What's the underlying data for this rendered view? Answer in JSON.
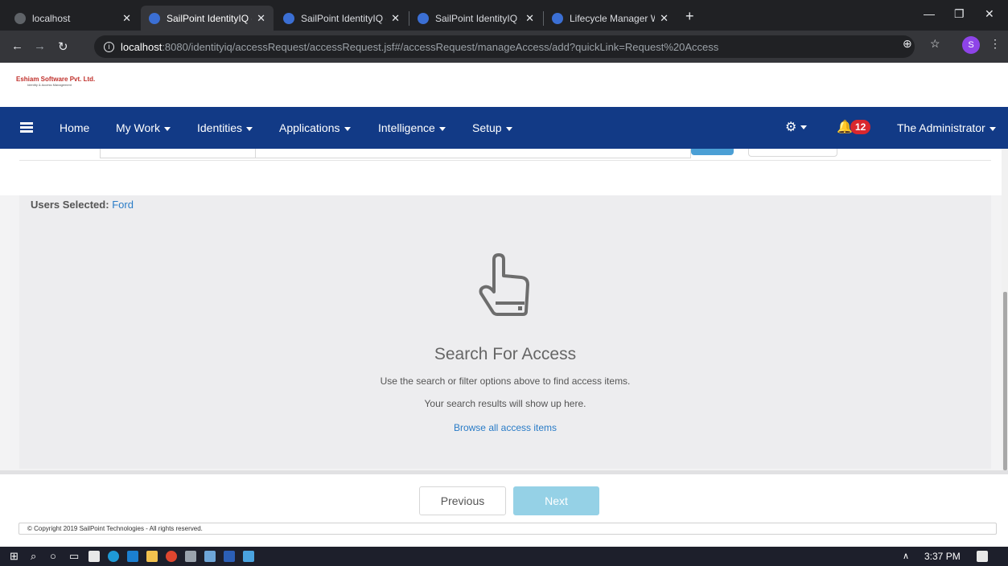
{
  "browser": {
    "tabs": [
      {
        "label": "localhost",
        "active": false
      },
      {
        "label": "SailPoint IdentityIQ - Manag",
        "active": true
      },
      {
        "label": "SailPoint IdentityIQ - Edit Id",
        "active": false
      },
      {
        "label": "SailPoint IdentityIQ - Acces",
        "active": false
      },
      {
        "label": "Lifecycle Manager Workflo",
        "active": false
      }
    ],
    "close_glyph": "✕",
    "newtab_glyph": "+",
    "url_host": "localhost",
    "url_rest": ":8080/identityiq/accessRequest/accessRequest.jsf#/accessRequest/manageAccess/add?quickLink=Request%20Access",
    "profile_initial": "S"
  },
  "logo": {
    "company": "Eshiam Software Pvt. Ltd.",
    "tagline": "Identity & Access Management"
  },
  "nav": {
    "home": "Home",
    "my_work": "My Work",
    "identities": "Identities",
    "applications": "Applications",
    "intelligence": "Intelligence",
    "setup": "Setup",
    "notification_count": "12",
    "user": "The Administrator"
  },
  "content": {
    "users_selected_label": "Users Selected:",
    "users_selected_value": "Ford",
    "title": "Search For Access",
    "subtitle1": "Use the search or filter options above to find access items.",
    "subtitle2": "Your search results will show up here.",
    "browse_link": "Browse all access items"
  },
  "footer": {
    "previous": "Previous",
    "next": "Next",
    "copyright": "© Copyright 2019 SailPoint Technologies - All rights reserved."
  },
  "taskbar": {
    "time": "3:37 PM"
  },
  "colors": {
    "navbar": "#123a86",
    "badge": "#d9272e",
    "link": "#2a7cc7",
    "next_button": "#95d1e6"
  }
}
